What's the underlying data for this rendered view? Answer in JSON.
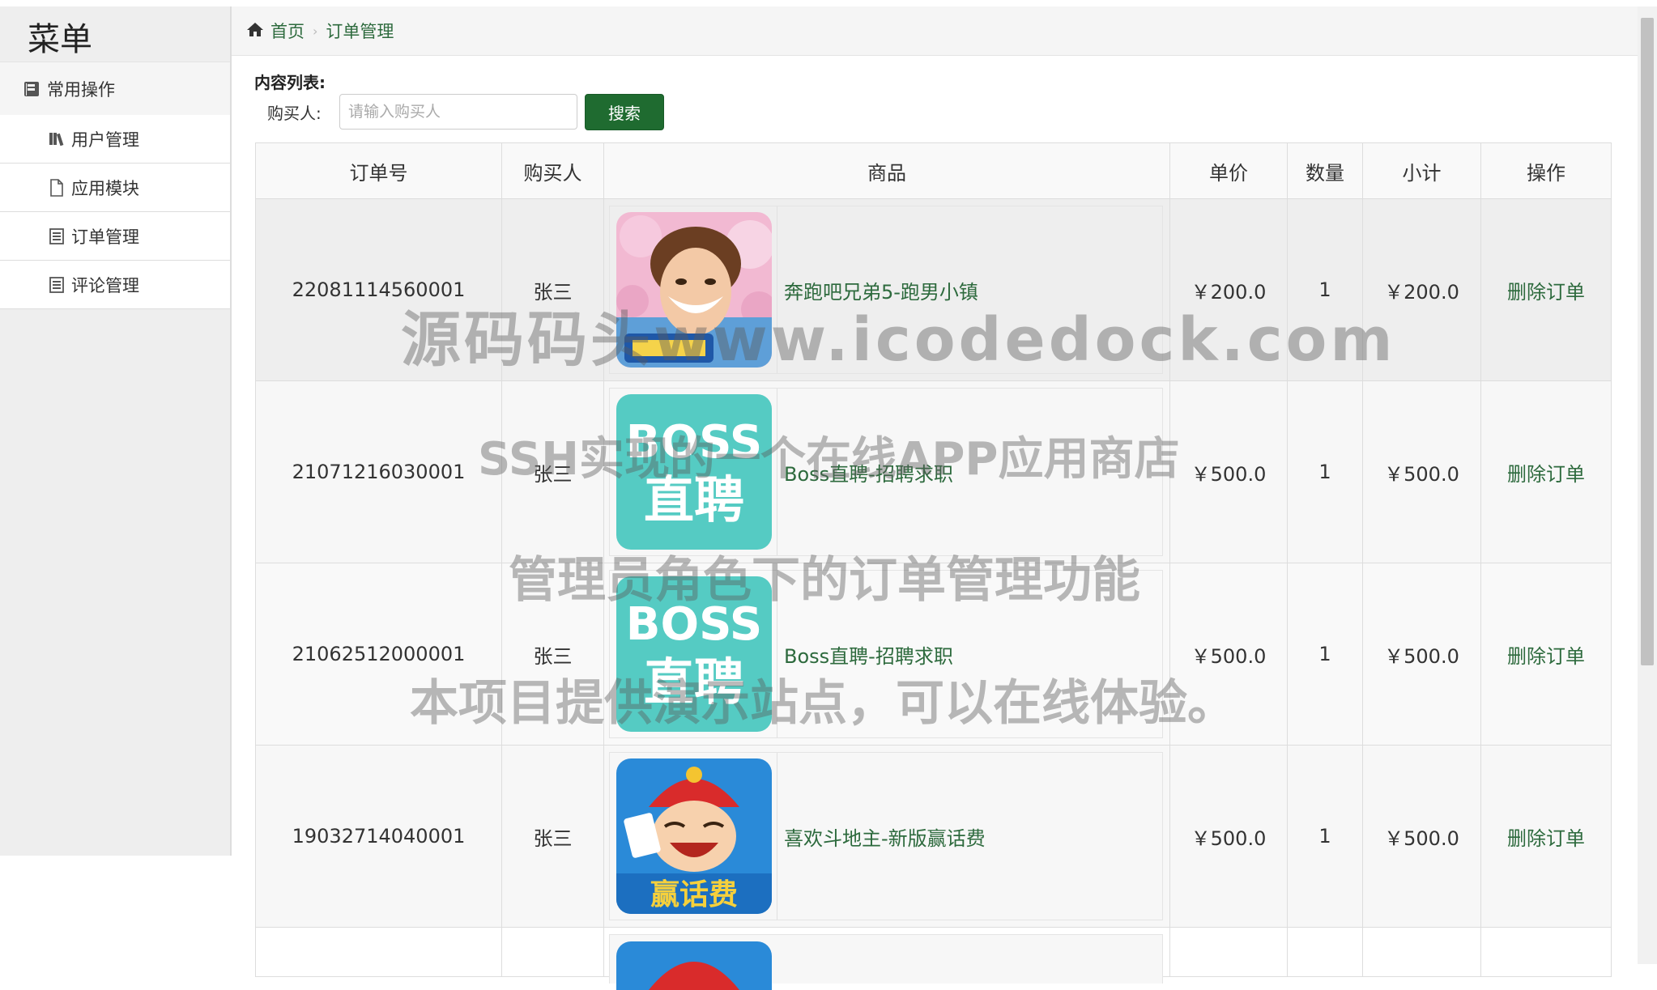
{
  "sidebar": {
    "title": "菜单",
    "group_label": "常用操作",
    "items": [
      {
        "label": "用户管理",
        "icon": "books-icon"
      },
      {
        "label": "应用模块",
        "icon": "file-icon"
      },
      {
        "label": "订单管理",
        "icon": "list-icon"
      },
      {
        "label": "评论管理",
        "icon": "list-icon"
      }
    ]
  },
  "breadcrumb": {
    "home": "首页",
    "current": "订单管理"
  },
  "main": {
    "content_label": "内容列表:",
    "search": {
      "label": "购买人:",
      "placeholder": "请输入购买人",
      "value": "",
      "button": "搜索"
    },
    "table": {
      "headers": [
        "订单号",
        "购买人",
        "商品",
        "单价",
        "数量",
        "小计",
        "操作"
      ],
      "rows": [
        {
          "order_no": "22081114560001",
          "buyer": "张三",
          "product": "奔跑吧兄弟5-跑男小镇",
          "image": "runningman-image",
          "price": "￥200.0",
          "qty": "1",
          "subtotal": "￥200.0",
          "action": "删除订单"
        },
        {
          "order_no": "21071216030001",
          "buyer": "张三",
          "product": "Boss直聘-招聘求职",
          "image": "boss-image",
          "price": "￥500.0",
          "qty": "1",
          "subtotal": "￥500.0",
          "action": "删除订单"
        },
        {
          "order_no": "21062512000001",
          "buyer": "张三",
          "product": "Boss直聘-招聘求职",
          "image": "boss-image",
          "price": "￥500.0",
          "qty": "1",
          "subtotal": "￥500.0",
          "action": "删除订单"
        },
        {
          "order_no": "19032714040001",
          "buyer": "张三",
          "product": "喜欢斗地主-新版赢话费",
          "image": "doudizhu-image",
          "price": "￥500.0",
          "qty": "1",
          "subtotal": "￥500.0",
          "action": "删除订单"
        }
      ]
    }
  },
  "watermark": {
    "line1": "源码码头www.icodedock.com",
    "line2": "SSH实现的一个在线APP应用商店",
    "line3": "管理员角色下的订单管理功能",
    "line4": "本项目提供演示站点，可以在线体验。"
  },
  "colors": {
    "accent": "#2d6a3d",
    "button": "#1f6b30",
    "boss": "#55cbc3"
  },
  "boss_image_text": {
    "top": "BOSS",
    "bottom": "直聘"
  },
  "doudizhu_image_text": "赢话费"
}
